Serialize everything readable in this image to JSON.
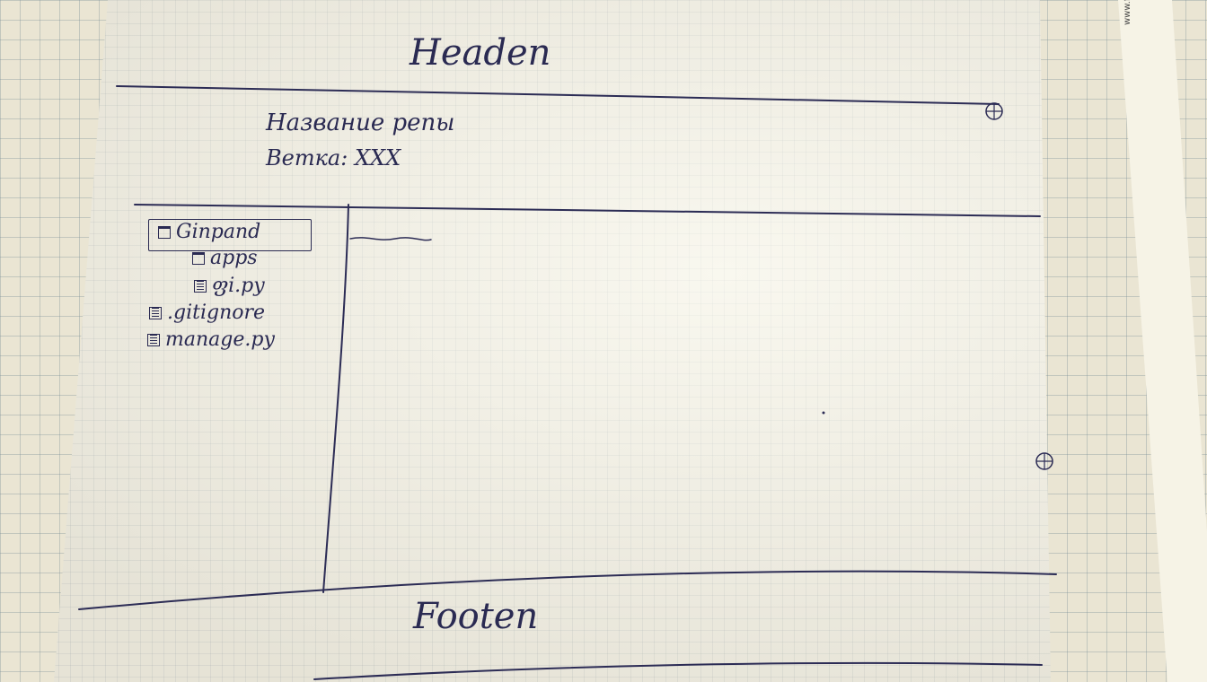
{
  "brand": {
    "text": "www.fakro"
  },
  "header": {
    "label": "Headen"
  },
  "repo": {
    "name": "Название репы",
    "branch": "Ветка: XXX"
  },
  "tree": {
    "items": [
      {
        "label": "Ginpand",
        "type": "folder",
        "selected": true
      },
      {
        "label": "apps",
        "type": "folder"
      },
      {
        "label": "ფi.py",
        "type": "file"
      },
      {
        "label": ".gitignore",
        "type": "file"
      },
      {
        "label": "manage.py",
        "type": "file"
      }
    ]
  },
  "footer": {
    "label": "Footen"
  }
}
